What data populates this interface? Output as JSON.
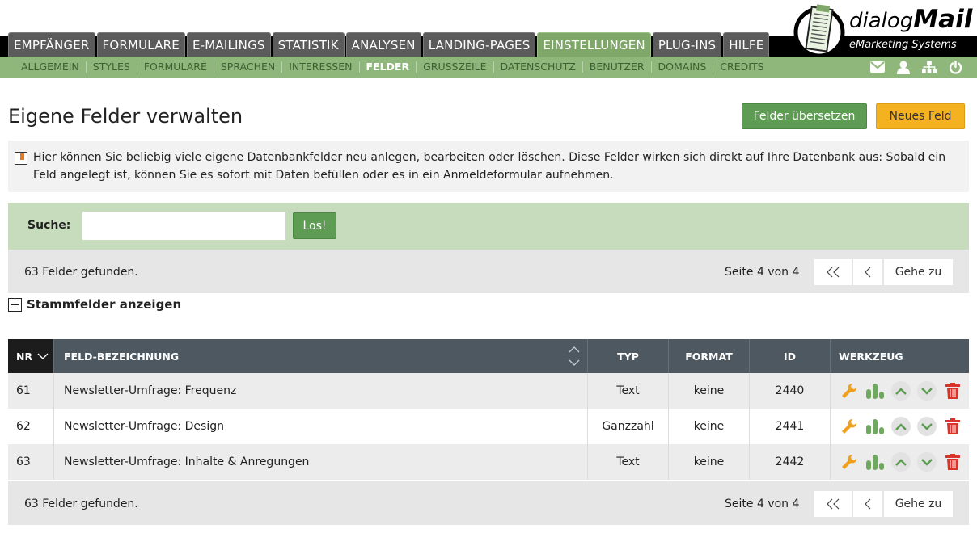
{
  "header": {
    "main_tabs": [
      "EMPFÄNGER",
      "FORMULARE",
      "E-MAILINGS",
      "STATISTIK",
      "ANALYSEN",
      "LANDING-PAGES",
      "EINSTELLUNGEN",
      "PLUG-INS",
      "HILFE"
    ],
    "active_tab": "EINSTELLUNGEN",
    "sub_nav": [
      "ALLGEMEIN",
      "STYLES",
      "FORMULARE",
      "SPRACHEN",
      "INTERESSEN",
      "FELDER",
      "GRUSSZEILE",
      "DATENSCHUTZ",
      "BENUTZER",
      "DOMAINS",
      "CREDITS"
    ],
    "active_sub": "FELDER",
    "icons": [
      "envelope-icon",
      "user-icon",
      "sitemap-icon",
      "power-icon"
    ],
    "logo": {
      "prefix": "dialog",
      "brand": "Mail",
      "tagline": "eMarketing Systems"
    }
  },
  "page": {
    "title": "Eigene Felder verwalten",
    "translate_button": "Felder übersetzen",
    "new_button": "Neues Feld",
    "info_text": "Hier können Sie beliebig viele eigene Datenbankfelder neu anlegen, bearbeiten oder löschen. Diese Felder wirken sich direkt auf Ihre Datenbank aus: Sobald ein Feld angelegt ist, können Sie es sofort mit Daten befüllen oder es in ein Anmeldeformular aufnehmen."
  },
  "search": {
    "label": "Suche:",
    "value": "",
    "placeholder": "",
    "button": "Los!"
  },
  "pager": {
    "count_text": "63 Felder gefunden.",
    "page_text": "Seite 4 von 4",
    "first_label": "<<",
    "prev_label": "<",
    "goto_label": "Gehe zu"
  },
  "stammfelder": {
    "label": "Stammfelder anzeigen"
  },
  "table": {
    "headers": {
      "nr": "NR",
      "name": "FELD-BEZEICHNUNG",
      "typ": "TYP",
      "format": "FORMAT",
      "id": "ID",
      "tool": "WERKZEUG"
    },
    "rows": [
      {
        "nr": "61",
        "name": "Newsletter-Umfrage: Frequenz",
        "typ": "Text",
        "format": "keine",
        "id": "2440"
      },
      {
        "nr": "62",
        "name": "Newsletter-Umfrage: Design",
        "typ": "Ganzzahl",
        "format": "keine",
        "id": "2441"
      },
      {
        "nr": "63",
        "name": "Newsletter-Umfrage: Inhalte & Anregungen",
        "typ": "Text",
        "format": "keine",
        "id": "2442"
      }
    ]
  },
  "colors": {
    "accent_green": "#5d9c52",
    "accent_orange": "#f4b120",
    "subnav_green": "#8fb77b",
    "table_header": "#4d5861",
    "delete_red": "#d8342c",
    "edit_orange": "#f0a01c"
  }
}
